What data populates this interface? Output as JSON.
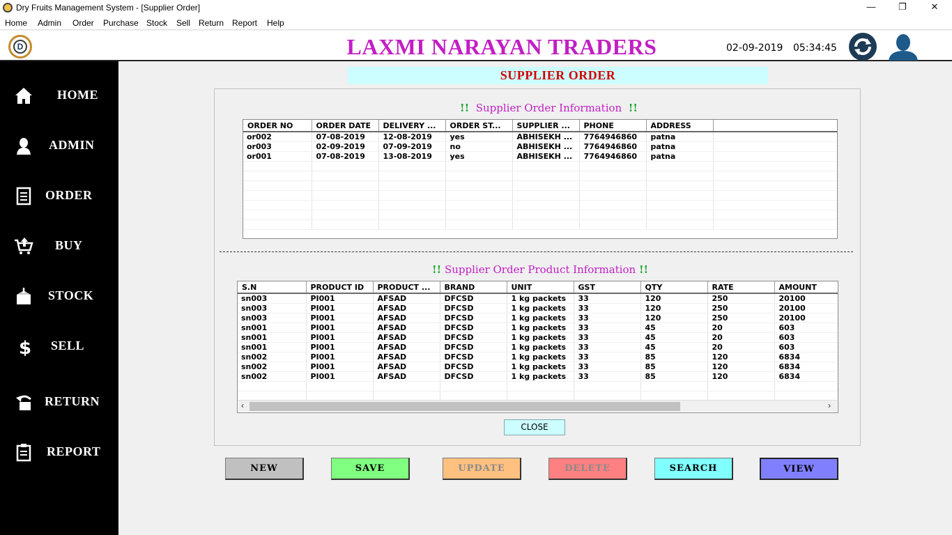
{
  "window": {
    "title": "Dry Fruits Management System - [Supplier Order]",
    "minimize": "—",
    "maximize": "❐",
    "close": "✕"
  },
  "menu": [
    "Home",
    "Admin",
    "Order",
    "Purchase",
    "Stock",
    "Sell",
    "Return",
    "Report",
    "Help"
  ],
  "header": {
    "logo_letter": "D",
    "company": "LAXMI NARAYAN TRADERS",
    "date": "02-09-2019",
    "time": "05:34:45"
  },
  "sidebar": [
    {
      "label": "HOME",
      "icon": "home-icon"
    },
    {
      "label": "ADMIN",
      "icon": "user-icon"
    },
    {
      "label": "ORDER",
      "icon": "document-icon"
    },
    {
      "label": "BUY",
      "icon": "cart-icon"
    },
    {
      "label": "STOCK",
      "icon": "box-icon"
    },
    {
      "label": "SELL",
      "icon": "dollar-icon"
    },
    {
      "label": "RETURN",
      "icon": "return-icon"
    },
    {
      "label": "REPORT",
      "icon": "clipboard-icon"
    }
  ],
  "page_title": "SUPPLIER  ORDER",
  "order_section": {
    "title": "Supplier Order Information",
    "bang": "!!",
    "columns": [
      "ORDER NO",
      "ORDER DATE",
      "DELIVERY ...",
      "ORDER ST...",
      "SUPPLIER ...",
      "PHONE",
      "ADDRESS"
    ],
    "rows": [
      [
        "or002",
        "07-08-2019",
        "12-08-2019",
        "yes",
        "ABHISEKH ...",
        "7764946860",
        "patna"
      ],
      [
        "or003",
        "02-09-2019",
        "07-09-2019",
        "no",
        "ABHISEKH ...",
        "7764946860",
        "patna"
      ],
      [
        "or001",
        "07-08-2019",
        "13-08-2019",
        "yes",
        "ABHISEKH ...",
        "7764946860",
        "patna"
      ]
    ]
  },
  "product_section": {
    "title": "Supplier Order Product Information",
    "bang": "!!",
    "columns": [
      "S.N",
      "PRODUCT ID",
      "PRODUCT ...",
      "BRAND",
      "UNIT",
      "GST",
      "QTY",
      "RATE",
      "AMOUNT"
    ],
    "rows": [
      [
        "sn003",
        "PI001",
        "AFSAD",
        "DFCSD",
        "1 kg packets",
        "33",
        "120",
        "250",
        "20100"
      ],
      [
        "sn003",
        "PI001",
        "AFSAD",
        "DFCSD",
        "1 kg packets",
        "33",
        "120",
        "250",
        "20100"
      ],
      [
        "sn003",
        "PI001",
        "AFSAD",
        "DFCSD",
        "1 kg packets",
        "33",
        "120",
        "250",
        "20100"
      ],
      [
        "sn001",
        "PI001",
        "AFSAD",
        "DFCSD",
        "1 kg packets",
        "33",
        "45",
        "20",
        "603"
      ],
      [
        "sn001",
        "PI001",
        "AFSAD",
        "DFCSD",
        "1 kg packets",
        "33",
        "45",
        "20",
        "603"
      ],
      [
        "sn001",
        "PI001",
        "AFSAD",
        "DFCSD",
        "1 kg packets",
        "33",
        "45",
        "20",
        "603"
      ],
      [
        "sn002",
        "PI001",
        "AFSAD",
        "DFCSD",
        "1 kg packets",
        "33",
        "85",
        "120",
        "6834"
      ],
      [
        "sn002",
        "PI001",
        "AFSAD",
        "DFCSD",
        "1 kg packets",
        "33",
        "85",
        "120",
        "6834"
      ],
      [
        "sn002",
        "PI001",
        "AFSAD",
        "DFCSD",
        "1 kg packets",
        "33",
        "85",
        "120",
        "6834"
      ]
    ]
  },
  "close_label": "CLOSE",
  "actions": [
    {
      "label": "NEW",
      "bg": "#c0c0c0",
      "color": "#000000"
    },
    {
      "label": "SAVE",
      "bg": "#80ff80",
      "color": "#000000"
    },
    {
      "label": "UPDATE",
      "bg": "#ffc080",
      "color": "#8a8a8a"
    },
    {
      "label": "DELETE",
      "bg": "#ff8080",
      "color": "#8a8a8a"
    },
    {
      "label": "SEARCH",
      "bg": "#80ffff",
      "color": "#000000"
    },
    {
      "label": "VIEW",
      "bg": "#8080ff",
      "color": "#000000"
    }
  ]
}
